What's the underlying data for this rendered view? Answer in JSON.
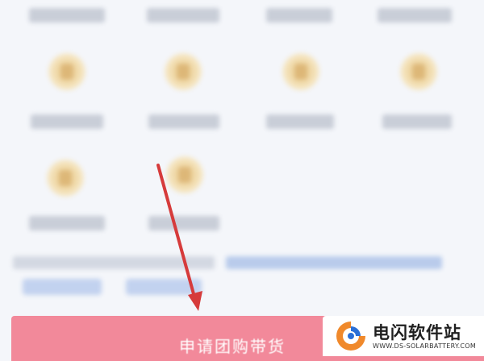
{
  "apply_button": {
    "label": "申请团购带货"
  },
  "watermark": {
    "title": "电闪软件站",
    "url": "WWW.DS-SOLARBATTERY.COM"
  },
  "icons": [
    "gift-icon",
    "gift-icon",
    "gift-icon",
    "gift-icon",
    "gift-icon",
    "gift-icon",
    "gift-icon",
    "gift-icon",
    "gift-icon",
    "gift-icon"
  ],
  "colors": {
    "apply_bar": "#f2899a",
    "arrow": "#d63b3b",
    "icon": "#e9c98b"
  }
}
